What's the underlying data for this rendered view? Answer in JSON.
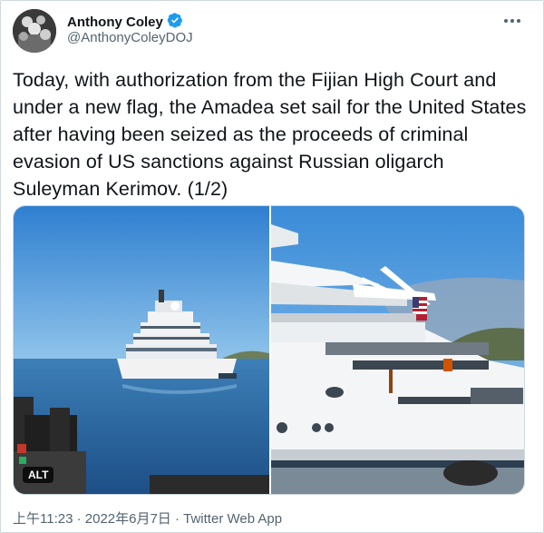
{
  "author": {
    "name": "Anthony Coley",
    "handle": "@AnthonyColeyDOJ",
    "verified": true
  },
  "tweet": {
    "text": "Today, with authorization from the Fijian High Court and under a new flag, the Amadea set sail for the United States after having been seized as the proceeds of criminal evasion of US sanctions against Russian oligarch Suleyman Kerimov. (1/2)"
  },
  "media": {
    "alt_badge": "ALT"
  },
  "meta": {
    "timestamp": "上午11:23 · 2022年6月7日 · Twitter Web App"
  },
  "colors": {
    "verified": "#1d9bf0",
    "secondary_text": "#536471",
    "border": "#cfd9de"
  },
  "icons": {
    "more": "more-icon",
    "verified": "verified-badge-icon"
  }
}
